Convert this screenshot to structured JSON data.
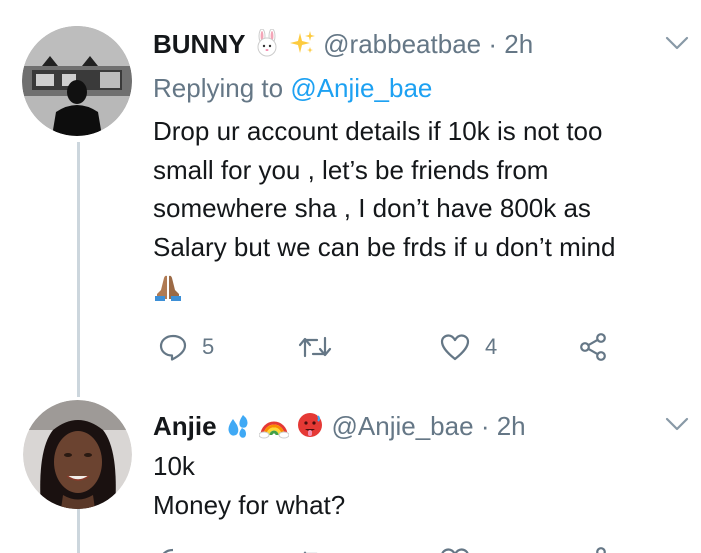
{
  "tweets": [
    {
      "display_name": "BUNNY",
      "name_emojis": [
        "rabbit-face-emoji",
        "sparkles-emoji"
      ],
      "handle": "@rabbeatbae",
      "time": "· 2h",
      "replying_prefix": "Replying to",
      "replying_handle": "@Anjie_bae",
      "body_lines": [
        "Drop ur account details if 10k is not too",
        "small for you , let’s be friends from",
        "somewhere sha , I don’t have 800k as",
        "Salary but we can be frds if u don’t mind"
      ],
      "body_emoji": "folded-hands-emoji",
      "reply_count": "5",
      "retweet_count": "",
      "like_count": "4"
    },
    {
      "display_name": "Anjie",
      "name_emojis": [
        "sweat-droplets-emoji",
        "rainbow-emoji",
        "hot-face-emoji"
      ],
      "handle": "@Anjie_bae",
      "time": "· 2h",
      "body_lines": [
        "10k",
        "Money for what?"
      ]
    }
  ],
  "colors": {
    "text": "#14171a",
    "secondary": "#657786",
    "link": "#1da1f2",
    "thread_line": "#ccd6dd",
    "icon": "#657786"
  }
}
